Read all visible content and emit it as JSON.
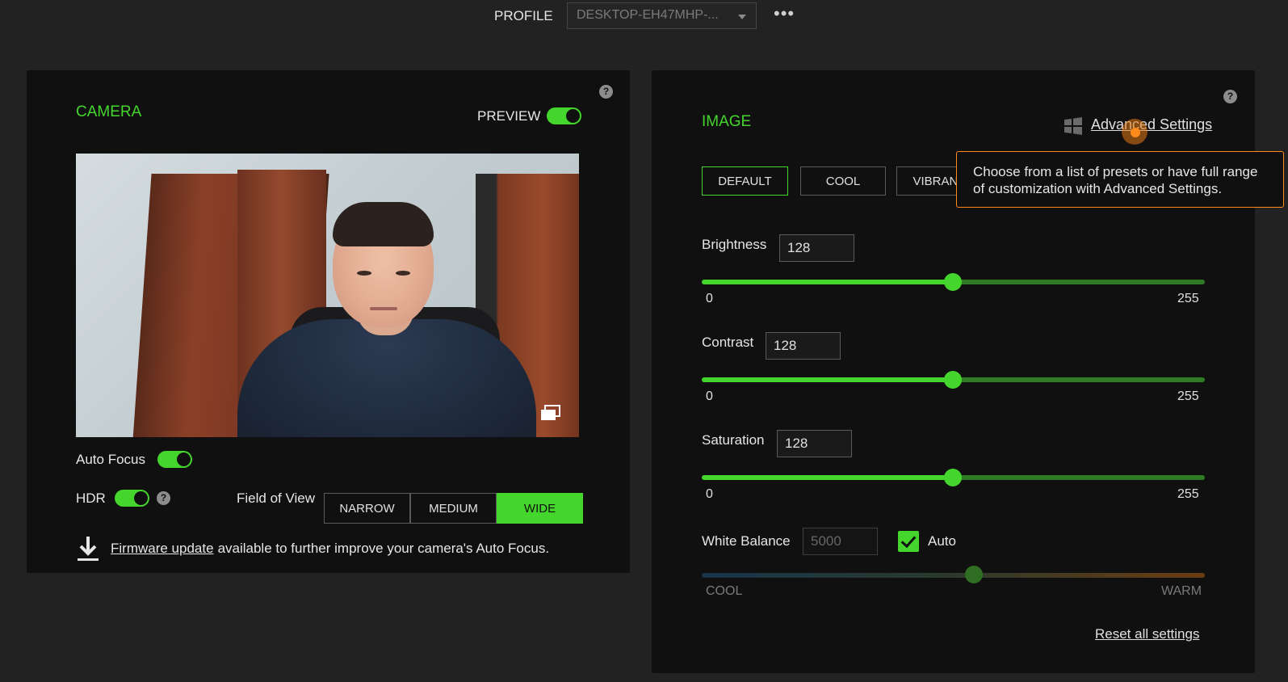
{
  "header": {
    "profile_label": "PROFILE",
    "profile_value": "DESKTOP-EH47MHP-...",
    "more_label": "•••"
  },
  "camera": {
    "title": "CAMERA",
    "preview_label": "PREVIEW",
    "preview_on": true,
    "auto_focus_label": "Auto Focus",
    "auto_focus_on": true,
    "hdr_label": "HDR",
    "hdr_on": true,
    "fov_label": "Field of View",
    "fov_options": [
      "NARROW",
      "MEDIUM",
      "WIDE"
    ],
    "fov_selected": "WIDE",
    "firmware_link": "Firmware update",
    "firmware_text": "available to further improve your camera's Auto Focus."
  },
  "image": {
    "title": "IMAGE",
    "advanced_link": "Advanced Settings",
    "presets": [
      "DEFAULT",
      "COOL",
      "VIBRANT"
    ],
    "preset_selected": "DEFAULT",
    "brightness": {
      "label": "Brightness",
      "value": "128",
      "min": "0",
      "max": "255"
    },
    "contrast": {
      "label": "Contrast",
      "value": "128",
      "min": "0",
      "max": "255"
    },
    "saturation": {
      "label": "Saturation",
      "value": "128",
      "min": "0",
      "max": "255"
    },
    "white_balance": {
      "label": "White Balance",
      "value": "5000",
      "auto_label": "Auto",
      "auto_checked": true,
      "min_label": "COOL",
      "max_label": "WARM",
      "level": 0.54
    },
    "reset_link": "Reset all settings"
  },
  "tooltip": {
    "line1": "Choose from a list of presets or have full range",
    "line2": "of customization with Advanced Settings."
  },
  "colors": {
    "accent": "#44d62c",
    "panel": "#101010",
    "background": "#222222",
    "tooltip_border": "#ff8c1a"
  }
}
